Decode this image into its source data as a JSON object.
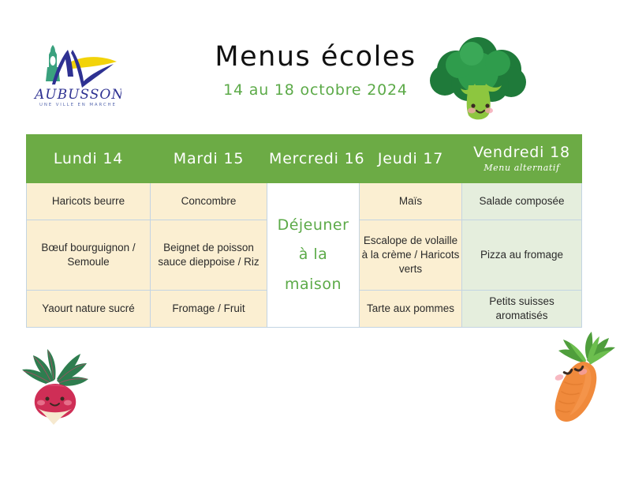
{
  "logo": {
    "name": "AUBUSSON",
    "tagline": "UNE VILLE EN MARCHE"
  },
  "header": {
    "title": "Menus écoles",
    "date_range": "14 au 18 octobre 2024"
  },
  "decorations": [
    {
      "icon": "broccoli-icon",
      "label": "Brocoli"
    },
    {
      "icon": "radish-icon",
      "label": "Radis"
    },
    {
      "icon": "carrot-icon",
      "label": "Carotte"
    }
  ],
  "colors": {
    "header_green": "#6cab45",
    "cell_cream": "#fbefd2",
    "cell_green": "#e5eedd",
    "accent_green": "#5caa48",
    "grid_line": "#c3d4e3",
    "logo_blue": "#2e3192",
    "logo_yellow": "#f2d30a",
    "logo_teal": "#3aa17e"
  },
  "table": {
    "columns": [
      {
        "day": "Lundi 14",
        "note": ""
      },
      {
        "day": "Mardi 15",
        "note": ""
      },
      {
        "day": "Mercredi 16",
        "note": ""
      },
      {
        "day": "Jeudi 17",
        "note": ""
      },
      {
        "day": "Vendredi 18",
        "note": "Menu alternatif"
      }
    ],
    "rows": {
      "entree": {
        "lundi": "Haricots beurre",
        "mardi": "Concombre",
        "jeudi": "Maïs",
        "vendredi": "Salade composée"
      },
      "plat": {
        "lundi": "Bœuf bourguignon / Semoule",
        "mardi": "Beignet de poisson sauce dieppoise / Riz",
        "jeudi": "Escalope de volaille à la crème / Haricots verts",
        "vendredi": "Pizza au fromage"
      },
      "dessert": {
        "lundi": "Yaourt nature sucré",
        "mardi": "Fromage / Fruit",
        "jeudi": "Tarte aux pommes",
        "vendredi": "Petits suisses aromatisés"
      }
    },
    "mercredi_cell": {
      "line1": "Déjeuner",
      "line2": "à la",
      "line3": "maison"
    }
  }
}
